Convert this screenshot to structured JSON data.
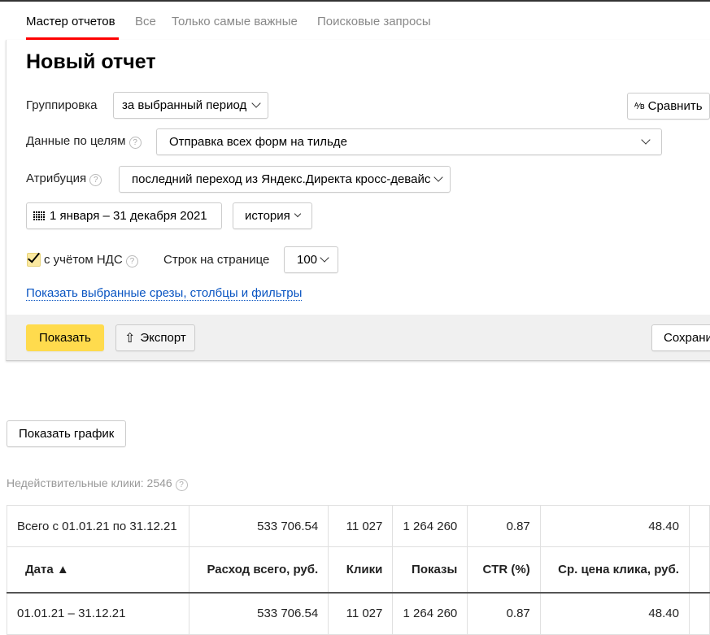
{
  "tabs": [
    {
      "label": "Мастер отчетов",
      "active": true
    },
    {
      "label": "Все"
    },
    {
      "label": "Только самые важные"
    },
    {
      "label": "Поисковые запросы"
    }
  ],
  "title": "Новый отчет",
  "grouping": {
    "label": "Группировка",
    "value": "за выбранный период"
  },
  "compare_label": "Сравнить",
  "goals": {
    "label": "Данные по целям",
    "value": "Отправка всех форм на тильде"
  },
  "attribution": {
    "label": "Атрибуция",
    "value": "последний переход из Яндекс.Директа кросс-девайс"
  },
  "period": "1 января – 31 декабря 2021",
  "history": "история",
  "vat": {
    "label": "с учётом НДС",
    "checked": true
  },
  "rows_per_page": {
    "label": "Строк на странице",
    "value": "100"
  },
  "show_filters_link": "Показать выбранные срезы, столбцы и фильтры",
  "show_button": "Показать",
  "export_button": "Экспорт",
  "save_button": "Сохрани",
  "show_chart_button": "Показать график",
  "invalid_clicks": "Недействительные клики: 2546",
  "colors": {
    "accent": "#ffdb4d",
    "tab_underline": "#ff0000",
    "link": "#0a55c2"
  },
  "table": {
    "totals": [
      "Всего с 01.01.21 по 31.12.21",
      "533 706.54",
      "11 027",
      "1 264 260",
      "0.87",
      "48.40"
    ],
    "headers": [
      "Дата ▲",
      "Расход всего, руб.",
      "Клики",
      "Показы",
      "CTR (%)",
      "Ср. цена клика, руб."
    ],
    "rows": [
      [
        "01.01.21 – 31.12.21",
        "533 706.54",
        "11 027",
        "1 264 260",
        "0.87",
        "48.40"
      ]
    ]
  }
}
